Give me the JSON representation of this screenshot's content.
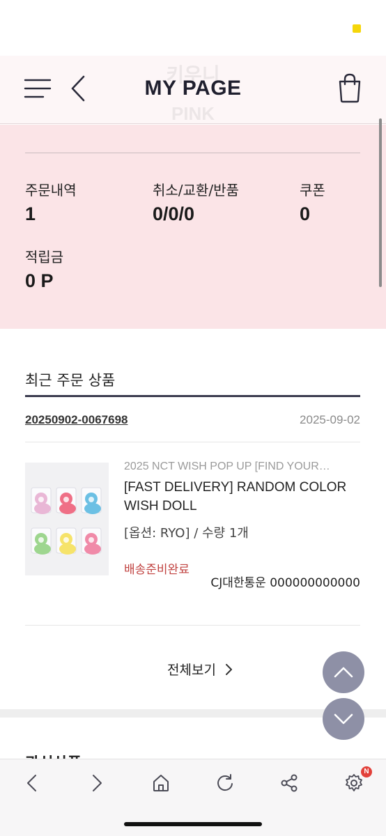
{
  "header": {
    "title": "MY PAGE",
    "ghost_top": "키우니",
    "ghost_bottom": "PINK"
  },
  "summary": {
    "orders": {
      "label": "주문내역",
      "value": "1"
    },
    "cancel_exchange_return": {
      "label": "취소/교환/반품",
      "value": "0/0/0"
    },
    "coupon": {
      "label": "쿠폰",
      "value": "0"
    },
    "points": {
      "label": "적립금",
      "value": "0 P"
    }
  },
  "recent_orders": {
    "title": "최근 주문 상품",
    "order_number": "20250902-0067698",
    "order_date": "2025-09-02",
    "product": {
      "event": "2025 NCT WISH POP UP [FIND YOUR…",
      "name": "[FAST DELIVERY] RANDOM COLOR WISH DOLL",
      "option": "[옵션: RYO] / 수량 1개",
      "status": "배송준비완료",
      "carrier": "CJ대한통운 000000000000",
      "doll_colors": [
        "#e9b7d6",
        "#ef6f86",
        "#6cc0e4",
        "#9ed68f",
        "#f6e36a",
        "#f08aa8"
      ]
    },
    "view_all": "전체보기"
  },
  "next_section": {
    "title_peek": "관심상품"
  },
  "bottom_nav": {
    "badge": "N"
  },
  "colors": {
    "summary_bg": "#fbe4e7",
    "header_bg": "#fdf6f7",
    "accent_dark": "#3a3b4e",
    "status_red": "#c0413f",
    "float_btn": "#8e90a6",
    "badge_red": "#e2403a"
  },
  "icons": [
    "hamburger-menu-icon",
    "chevron-left-icon",
    "shopping-bag-icon",
    "chevron-right-icon",
    "chevron-up-icon",
    "chevron-down-icon",
    "home-icon",
    "refresh-icon",
    "share-icon",
    "settings-icon"
  ]
}
